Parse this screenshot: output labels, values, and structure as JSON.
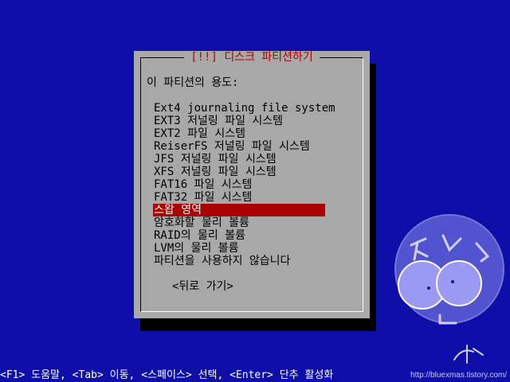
{
  "dialog": {
    "title": "[!!] 디스크 파티션하기",
    "question": "이 파티션의 용도:",
    "options": [
      "Ext4 journaling file system",
      "EXT3 저널링 파일 시스템",
      "EXT2 파일 시스템",
      "ReiserFS 저널링 파일 시스템",
      "JFS 저널링 파일 시스템",
      "XFS 저널링 파일 시스템",
      "FAT16 파일 시스템",
      "FAT32 파일 시스템",
      "스왑 영역",
      "암호화할 물리 볼륨",
      "RAID의 물리 볼륨",
      "LVM의 물리 볼륨",
      "파티션을 사용하지 않습니다"
    ],
    "selected_index": 8,
    "back_label": "<뒤로 가기>"
  },
  "help_bar": {
    "text": "<F1> 도움말, <Tab> 이동, <스페이스> 선택, <Enter> 단추 활성화"
  },
  "watermark": {
    "url": "http://bluexmas.tistory.com/"
  },
  "colors": {
    "background": "#0d0fa8",
    "dialog": "#a8a8a8",
    "title": "#b00000",
    "selected": "#a80000"
  }
}
